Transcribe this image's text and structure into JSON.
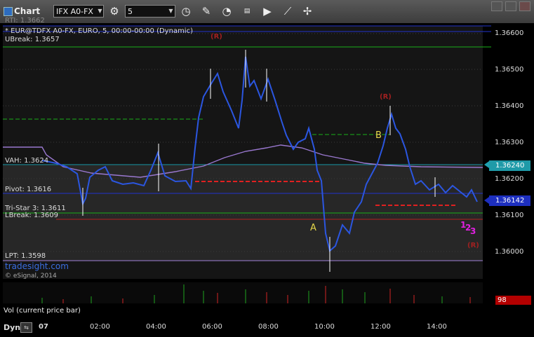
{
  "window": {
    "title": "Chart"
  },
  "toolbar": {
    "symbol_value": "IFX A0-FX",
    "interval_value": "5",
    "icons": [
      "clock-icon",
      "pencil-icon",
      "gauge-icon",
      "studies-icon",
      "play-icon",
      "crosshair-icon"
    ]
  },
  "chart": {
    "header_partial": "RTI: 1.3662",
    "series_label": "* EUR@TDFX A0-FX, EURO, 5, 00:00-00:00 (Dynamic)",
    "ubreak": "UBreak: 1.3657",
    "vah": "VAH: 1.3624",
    "pivot": "Pivot: 1.3616",
    "tristar": "Tri-Star 3: 1.3611",
    "lbreak": "LBreak: 1.3609",
    "lpt": "LPT: 1.3598",
    "watermark": "tradesight.com",
    "copyright": "© eSignal, 2014",
    "price_tags": [
      {
        "text": "1.36240",
        "color": "#1f9aa8"
      },
      {
        "text": "1.36142",
        "color": "#1d2fbf"
      }
    ],
    "y_ticks": [
      "1.36600",
      "1.36500",
      "1.36400",
      "1.36300",
      "1.36200",
      "1.36100",
      "1.36000"
    ],
    "x_ticks": [
      "07",
      "02:00",
      "04:00",
      "06:00",
      "08:00",
      "10:00",
      "12:00",
      "14:00"
    ],
    "annotations": {
      "a": "A",
      "b": "B",
      "r_top1": "(R)",
      "r_top2": "(R)",
      "r_bottom": "(R)",
      "one": "1",
      "two": "2",
      "three": "3"
    }
  },
  "volume": {
    "title": "Vol (current price bar)",
    "value": "98"
  },
  "footer": {
    "dyn": "Dyn"
  }
}
